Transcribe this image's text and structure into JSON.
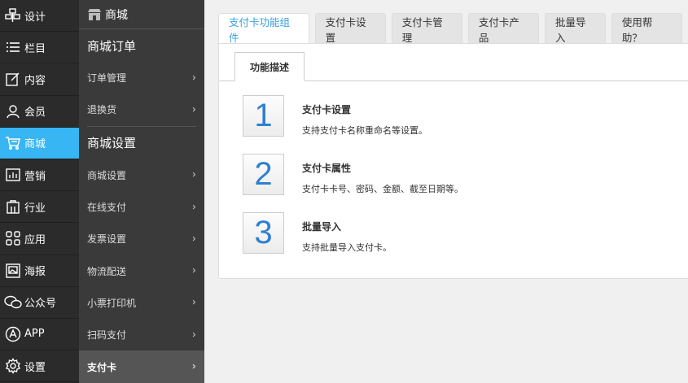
{
  "nav1": {
    "items": [
      {
        "label": "设计",
        "icon": "design-icon"
      },
      {
        "label": "栏目",
        "icon": "list-icon"
      },
      {
        "label": "内容",
        "icon": "edit-icon"
      },
      {
        "label": "会员",
        "icon": "user-icon"
      },
      {
        "label": "商城",
        "icon": "cart-icon"
      },
      {
        "label": "营销",
        "icon": "chart-icon"
      },
      {
        "label": "行业",
        "icon": "store-icon"
      },
      {
        "label": "应用",
        "icon": "grid-icon"
      },
      {
        "label": "海报",
        "icon": "poster-icon"
      },
      {
        "label": "公众号",
        "icon": "chat-icon"
      },
      {
        "label": "APP",
        "icon": "app-icon"
      },
      {
        "label": "设置",
        "icon": "gear-icon"
      }
    ],
    "active_color": "#38b6f3"
  },
  "nav2": {
    "head": "商城",
    "section1": "商城订单",
    "links1": [
      "订单管理",
      "退换货"
    ],
    "section2": "商城设置",
    "links2": [
      "商城设置",
      "在线支付",
      "发票设置",
      "物流配送",
      "小票打印机",
      "扫码支付",
      "支付卡"
    ]
  },
  "tabs": [
    "支付卡功能组件",
    "支付卡设置",
    "支付卡管理",
    "支付卡产品",
    "批量导入",
    "使用帮助？"
  ],
  "subtab": "功能描述",
  "features": [
    {
      "num": "1",
      "title": "支付卡设置",
      "desc": "支持支付卡名称重命名等设置。"
    },
    {
      "num": "2",
      "title": "支付卡属性",
      "desc": "支付卡卡号、密码、金额、截至日期等。"
    },
    {
      "num": "3",
      "title": "批量导入",
      "desc": "支持批量导入支付卡。"
    }
  ]
}
